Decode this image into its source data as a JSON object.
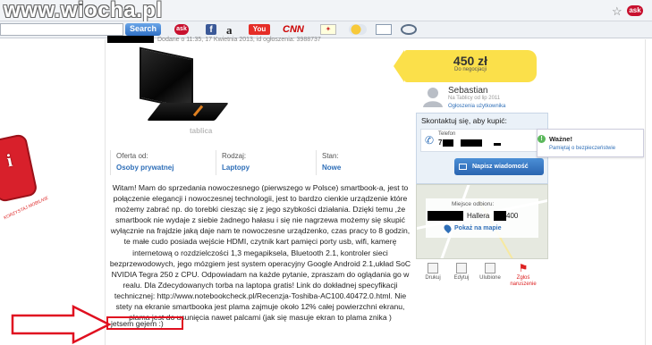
{
  "watermark": "www.wiocha.pl",
  "browser": {
    "search_button": "Search",
    "icons": [
      "star-icon",
      "ask-icon",
      "facebook-icon",
      "amazon-icon",
      "youtube-icon",
      "cnn-icon",
      "news-icon",
      "weather-icon",
      "mail-icon",
      "ring-icon"
    ],
    "amazon": "a",
    "youtube": "You",
    "cnn": "CNN",
    "ask": "ask",
    "facebook": "f"
  },
  "listing": {
    "meta": "Dodane o 11:35, 17 Kwietnia 2013, id ogłoszenia: 3988737",
    "photo_watermark": "tablica",
    "info": [
      {
        "label": "Oferta od:",
        "value": "Osoby prywatnej"
      },
      {
        "label": "Rodzaj:",
        "value": "Laptopy"
      },
      {
        "label": "Stan:",
        "value": "Nowe"
      }
    ],
    "description": "Witam! Mam do sprzedania nowoczesnego (pierwszego w Polsce) smartbook-a, jest to połączenie elegancji i nowoczesnej technologii, jest to bardzo cienkie urządzenie które możemy zabrać np. do torebki ciesząc się z jego szybkości działania. Dzięki temu ,że smartbook nie wydaje z siebie żadnego hałasu i się nie nagrzewa możemy się skupić wyłącznie na frajdzie jaką daje nam te nowoczesne urządzenko, czas pracy to 8 godzin, te małe cudo posiada wejście HDMI, czytnik kart pamięci porty usb, wifi, kamerę internetową o rozdzielczości 1,3 megapiksela, Bluetooth 2.1, kontroler sieci bezprzewodowych, jego mózgiem jest system operacyjny Google Android 2.1,układ SoC NVIDIA Tegra 250 z CPU. Odpowiadam na każde pytanie, zpraszam do oglądania go w realu. Dla Zdecydowanych torba na laptopa gratis! Link do dokładnej specyfikacji technicznej: http://www.notebookcheck.pl/Recenzja-Toshiba-AC100.40472.0.html. Nie stety na ekranie smartbooka jest plama zajmuje około 12% całej powierzchni ekranu, plama jest do usunięcia nawet palcami (jak się masuje ekran to plama znika )",
    "description_last": "jetsem gejem :)"
  },
  "price": {
    "value": "450 zł",
    "note": "Do negocjacji"
  },
  "seller": {
    "name": "Sebastian",
    "since": "Na Tablicy od lip 2011",
    "link": "Ogłoszenia użytkownika"
  },
  "contact": {
    "heading": "Skontaktuj się, aby kupić:",
    "phone_label": "Telefon",
    "phone_number": "7  5  ",
    "message_button": "Napisz wiadomość"
  },
  "tooltip": {
    "title": "Ważne!",
    "link": "Pamiętaj o bezpieczeństwie"
  },
  "location": {
    "label": "Miejsce odbioru:",
    "address": "Hallera",
    "address_number": "400",
    "map_link": "Pokaż na mapie"
  },
  "actions": [
    {
      "label": "Drukuj",
      "icon": "print-icon"
    },
    {
      "label": "Edytuj",
      "icon": "edit-icon"
    },
    {
      "label": "Ulubione",
      "icon": "star-icon"
    },
    {
      "label": "Zgłoś naruszenie",
      "icon": "flag-icon"
    }
  ],
  "ad": {
    "caption": "KORZYSTAJ MOBILNIE"
  },
  "colors": {
    "link": "#2f6fb8",
    "price_tag": "#fbe04a",
    "button": "#2a64b0",
    "highlight": "#e01020"
  }
}
